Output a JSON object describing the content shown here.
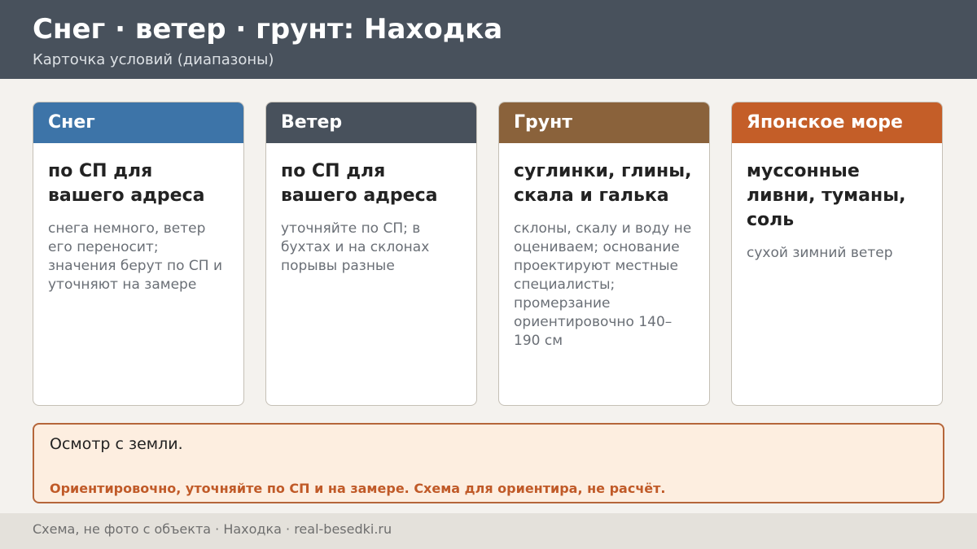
{
  "header": {
    "title": "Снег · ветер · грунт: Находка",
    "subtitle": "Карточка условий (диапазоны)"
  },
  "cards": [
    {
      "title": "Снег",
      "color": "#3d74a8",
      "main": "по СП для вашего адреса",
      "note": "снега немного, ветер его переносит; значения берут по СП и уточняют на замере"
    },
    {
      "title": "Ветер",
      "color": "#48515c",
      "main": "по СП для вашего адреса",
      "note": "уточняйте по СП; в бухтах и на склонах порывы разные"
    },
    {
      "title": "Грунт",
      "color": "#8a623b",
      "main": "суглинки, глины, скала и галька",
      "note": "склоны, скалу и воду не оцениваем; основание проектируют местные специалисты; промерзание ориентировочно 140–190 см"
    },
    {
      "title": "Японское море",
      "color": "#c45e28",
      "main": "муссонные ливни, туманы, соль",
      "note": "сухой зимний ветер"
    }
  ],
  "notice": {
    "main": "Осмотр с земли.",
    "note": "Ориентировочно, уточняйте по СП и на замере. Схема для ориентира, не расчёт."
  },
  "footer": {
    "text": "Схема, не фото с объекта  ·  Находка  ·  real-besedki.ru"
  }
}
